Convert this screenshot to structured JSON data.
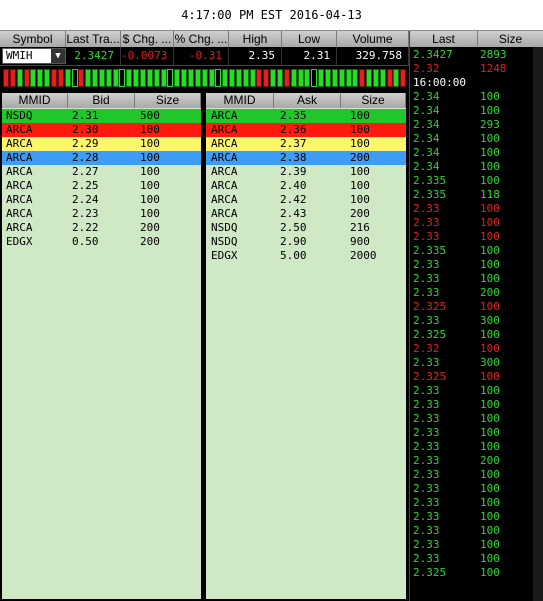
{
  "clock": "4:17:00 PM EST 2016-04-13",
  "quote": {
    "headers": [
      "Symbol",
      "Last Tra...",
      "$ Chg. ...",
      "% Chg. ...",
      "High",
      "Low",
      "Volume"
    ],
    "symbol": "WMIH",
    "last": "2.3427",
    "chg": "-0.0073",
    "pct": "-0.31",
    "high": "2.35",
    "low": "2.31",
    "volume": "329.758"
  },
  "tick_sequence": "dduduuudduuduuuuuuuuuuuuuuuuuuuuuuuuudduuduuuuuuuuuuduuudud",
  "colors": {
    "up": "#2bd82b",
    "down": "#e21f1f",
    "level1": "#21c62b",
    "level2": "#ff1a0d",
    "level3": "#fff56b",
    "level4": "#3d9cf5",
    "rest": "#cfe8c6"
  },
  "bid": {
    "headers": [
      "MMID",
      "Bid",
      "Size"
    ],
    "rows": [
      [
        "NSDQ",
        "2.31",
        "500"
      ],
      [
        "ARCA",
        "2.30",
        "100"
      ],
      [
        "ARCA",
        "2.29",
        "100"
      ],
      [
        "ARCA",
        "2.28",
        "100"
      ],
      [
        "ARCA",
        "2.27",
        "100"
      ],
      [
        "ARCA",
        "2.25",
        "100"
      ],
      [
        "ARCA",
        "2.24",
        "100"
      ],
      [
        "ARCA",
        "2.23",
        "100"
      ],
      [
        "ARCA",
        "2.22",
        "200"
      ],
      [
        "EDGX",
        "0.50",
        "200"
      ]
    ]
  },
  "ask": {
    "headers": [
      "MMID",
      "Ask",
      "Size"
    ],
    "rows": [
      [
        "ARCA",
        "2.35",
        "100"
      ],
      [
        "ARCA",
        "2.36",
        "100"
      ],
      [
        "ARCA",
        "2.37",
        "100"
      ],
      [
        "ARCA",
        "2.38",
        "200"
      ],
      [
        "ARCA",
        "2.39",
        "100"
      ],
      [
        "ARCA",
        "2.40",
        "100"
      ],
      [
        "ARCA",
        "2.42",
        "100"
      ],
      [
        "ARCA",
        "2.43",
        "200"
      ],
      [
        "NSDQ",
        "2.50",
        "216"
      ],
      [
        "NSDQ",
        "2.90",
        "900"
      ],
      [
        "EDGX",
        "5.00",
        "2000"
      ]
    ]
  },
  "time_sales": {
    "headers": [
      "Last",
      "Size"
    ],
    "rows": [
      {
        "last": "2.3427",
        "size": "2893",
        "color": "up"
      },
      {
        "last": "2.32",
        "size": "1248",
        "color": "down"
      },
      {
        "last": "16:00:00",
        "size": "",
        "color": "white"
      },
      {
        "last": "2.34",
        "size": "100",
        "color": "up"
      },
      {
        "last": "2.34",
        "size": "100",
        "color": "up"
      },
      {
        "last": "2.34",
        "size": "293",
        "color": "up"
      },
      {
        "last": "2.34",
        "size": "100",
        "color": "up"
      },
      {
        "last": "2.34",
        "size": "100",
        "color": "up"
      },
      {
        "last": "2.34",
        "size": "100",
        "color": "up"
      },
      {
        "last": "2.335",
        "size": "100",
        "color": "up"
      },
      {
        "last": "2.335",
        "size": "118",
        "color": "up"
      },
      {
        "last": "2.33",
        "size": "100",
        "color": "down"
      },
      {
        "last": "2.33",
        "size": "100",
        "color": "down"
      },
      {
        "last": "2.33",
        "size": "100",
        "color": "down"
      },
      {
        "last": "2.335",
        "size": "100",
        "color": "up"
      },
      {
        "last": "2.33",
        "size": "100",
        "color": "up"
      },
      {
        "last": "2.33",
        "size": "100",
        "color": "up"
      },
      {
        "last": "2.33",
        "size": "200",
        "color": "up"
      },
      {
        "last": "2.325",
        "size": "100",
        "color": "down"
      },
      {
        "last": "2.33",
        "size": "300",
        "color": "up"
      },
      {
        "last": "2.325",
        "size": "100",
        "color": "up"
      },
      {
        "last": "2.32",
        "size": "100",
        "color": "down"
      },
      {
        "last": "2.33",
        "size": "300",
        "color": "up"
      },
      {
        "last": "2.325",
        "size": "100",
        "color": "down"
      },
      {
        "last": "2.33",
        "size": "100",
        "color": "up"
      },
      {
        "last": "2.33",
        "size": "100",
        "color": "up"
      },
      {
        "last": "2.33",
        "size": "100",
        "color": "up"
      },
      {
        "last": "2.33",
        "size": "100",
        "color": "up"
      },
      {
        "last": "2.33",
        "size": "100",
        "color": "up"
      },
      {
        "last": "2.33",
        "size": "200",
        "color": "up"
      },
      {
        "last": "2.33",
        "size": "100",
        "color": "up"
      },
      {
        "last": "2.33",
        "size": "100",
        "color": "up"
      },
      {
        "last": "2.33",
        "size": "100",
        "color": "up"
      },
      {
        "last": "2.33",
        "size": "100",
        "color": "up"
      },
      {
        "last": "2.33",
        "size": "100",
        "color": "up"
      },
      {
        "last": "2.33",
        "size": "100",
        "color": "up"
      },
      {
        "last": "2.33",
        "size": "100",
        "color": "up"
      },
      {
        "last": "2.325",
        "size": "100",
        "color": "up"
      }
    ]
  }
}
